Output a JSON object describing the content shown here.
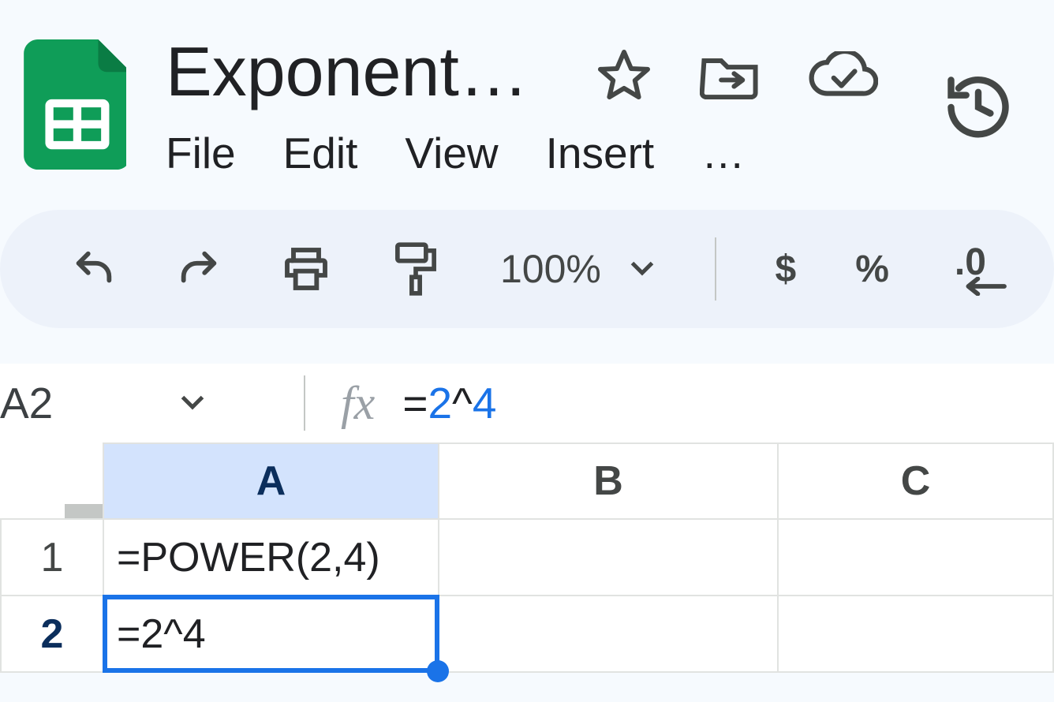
{
  "doc": {
    "title": "Exponent…"
  },
  "menu": {
    "file": "File",
    "edit": "Edit",
    "view": "View",
    "insert": "Insert",
    "more": "…"
  },
  "toolbar": {
    "zoom": "100%",
    "currency": "$",
    "percent": "%",
    "dec_decrease": ".0"
  },
  "formula": {
    "name_box": "A2",
    "fx_label": "fx",
    "raw": "=2^4",
    "prefix": "=",
    "n1": "2",
    "caret": "^",
    "n2": "4"
  },
  "columns": [
    "A",
    "B",
    "C"
  ],
  "rows": [
    {
      "num": "1",
      "A": "=POWER(2,4)",
      "B": "",
      "C": ""
    },
    {
      "num": "2",
      "A": "=2^4",
      "B": "",
      "C": ""
    }
  ],
  "active_cell": "A2"
}
